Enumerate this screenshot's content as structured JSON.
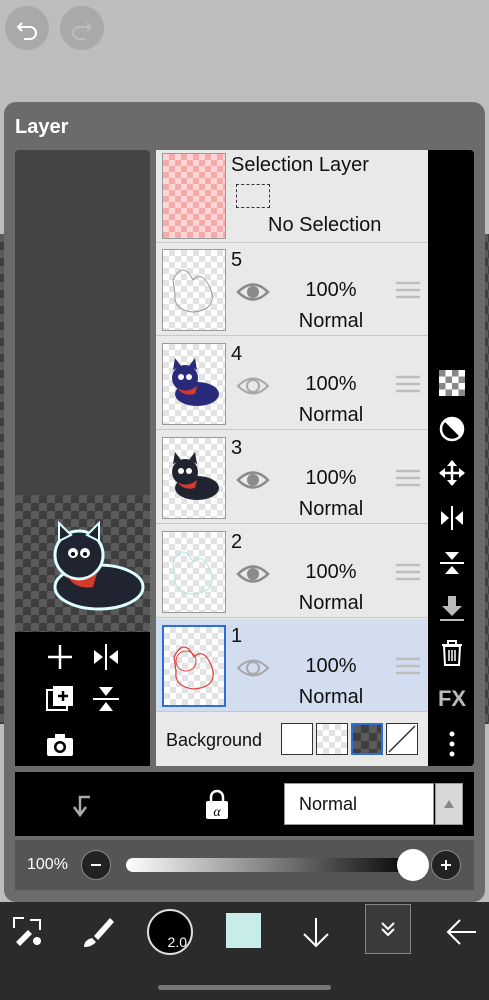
{
  "panel": {
    "title": "Layer"
  },
  "selection_layer": {
    "title": "Selection Layer",
    "status": "No Selection"
  },
  "layers": [
    {
      "number": "5",
      "opacity": "100%",
      "blend": "Normal",
      "visible": true
    },
    {
      "number": "4",
      "opacity": "100%",
      "blend": "Normal",
      "visible": false
    },
    {
      "number": "3",
      "opacity": "100%",
      "blend": "Normal",
      "visible": true
    },
    {
      "number": "2",
      "opacity": "100%",
      "blend": "Normal",
      "visible": true
    },
    {
      "number": "1",
      "opacity": "100%",
      "blend": "Normal",
      "visible": false,
      "selected": true
    }
  ],
  "background_label": "Background",
  "fx_label": "FX",
  "blend_mode": {
    "value": "Normal"
  },
  "opacity_slider": {
    "label": "100%",
    "value": 1.0
  },
  "brush_size": "2.0",
  "colors": {
    "current": "#c7ecea",
    "accent": "#2a70d8"
  }
}
